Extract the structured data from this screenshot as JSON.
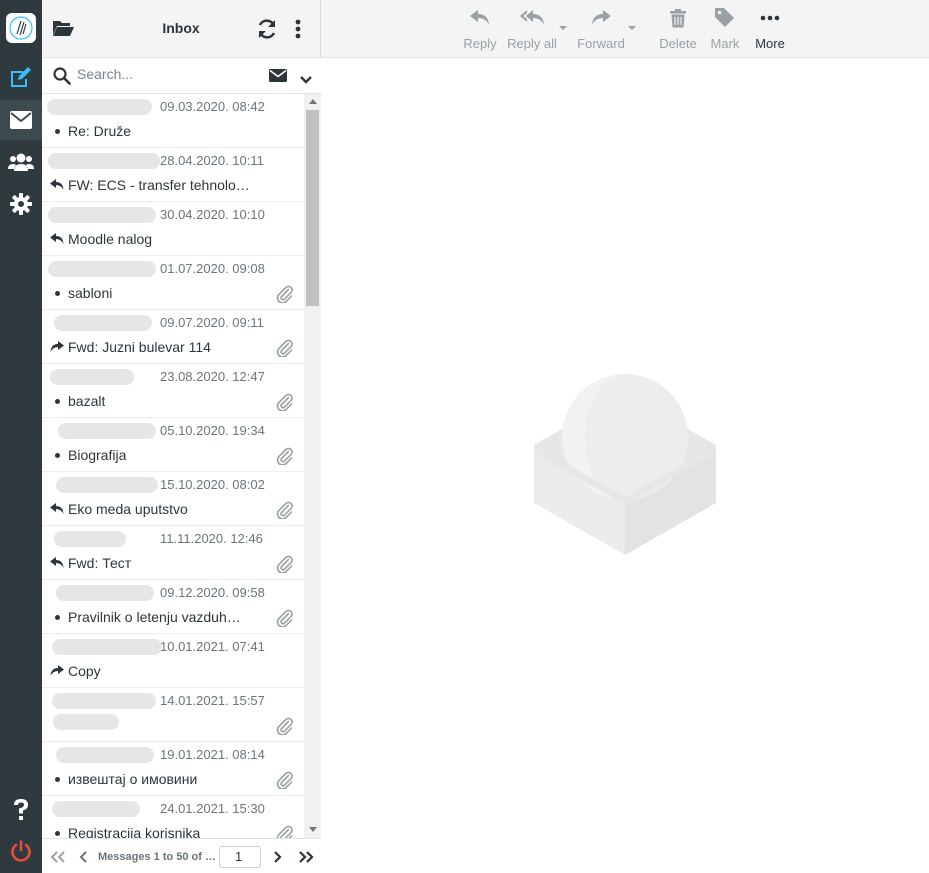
{
  "folder": {
    "title": "Inbox"
  },
  "search": {
    "placeholder": "Search..."
  },
  "toolbar": {
    "reply": "Reply",
    "reply_all": "Reply all",
    "forward": "Forward",
    "delete": "Delete",
    "mark": "Mark",
    "more": "More"
  },
  "messages": [
    {
      "date": "09.03.2020. 08:42",
      "subject": "Re: Druže",
      "status": "unread",
      "attachment": false
    },
    {
      "date": "28.04.2020. 10:11",
      "subject": "FW: ECS - transfer tehnolo…",
      "status": "replied",
      "attachment": false
    },
    {
      "date": "30.04.2020. 10:10",
      "subject": "Moodle nalog",
      "status": "replied",
      "attachment": false
    },
    {
      "date": "01.07.2020. 09:08",
      "subject": "sabloni",
      "status": "unread",
      "attachment": true
    },
    {
      "date": "09.07.2020. 09:11",
      "subject": "Fwd: Juzni bulevar 114",
      "status": "forwarded",
      "attachment": true
    },
    {
      "date": "23.08.2020. 12:47",
      "subject": "bazalt",
      "status": "unread",
      "attachment": true
    },
    {
      "date": "05.10.2020. 19:34",
      "subject": "Biografija",
      "status": "unread",
      "attachment": true
    },
    {
      "date": "15.10.2020. 08:02",
      "subject": "Eko meda uputstvo",
      "status": "replied",
      "attachment": true
    },
    {
      "date": "11.11.2020. 12:46",
      "subject": "Fwd: Тест",
      "status": "replied",
      "attachment": true
    },
    {
      "date": "09.12.2020. 09:58",
      "subject": "Pravilnik o letenju vazduh…",
      "status": "unread",
      "attachment": true
    },
    {
      "date": "10.01.2021. 07:41",
      "subject": "Copy",
      "status": "forwarded",
      "attachment": false
    },
    {
      "date": "14.01.2021. 15:57",
      "subject": "",
      "status": "none",
      "attachment": true
    },
    {
      "date": "19.01.2021. 08:14",
      "subject": "извештај о имовини",
      "status": "unread",
      "attachment": true
    },
    {
      "date": "24.01.2021. 15:30",
      "subject": "Registracija korisnika",
      "status": "unread",
      "attachment": true
    }
  ],
  "pagination": {
    "info": "Messages 1 to 50 of …",
    "page": "1"
  },
  "colors": {
    "rail": "#2f3a3f",
    "accent": "#37beff",
    "logout": "#e74c3c"
  }
}
